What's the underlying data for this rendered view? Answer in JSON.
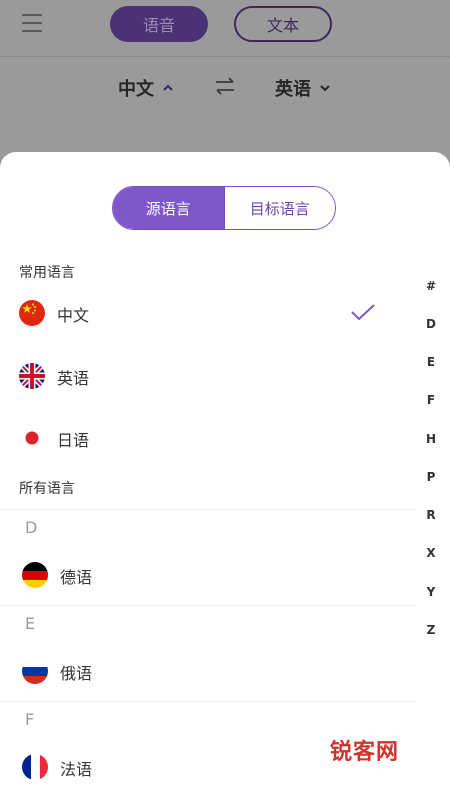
{
  "topbar": {
    "voice_label": "语音",
    "text_label": "文本"
  },
  "langbar": {
    "source": "中文",
    "target": "英语"
  },
  "segmented": {
    "source_label": "源语言",
    "target_label": "目标语言"
  },
  "common": {
    "title": "常用语言",
    "items": [
      {
        "name": "中文",
        "flag": "cn-flag-icon",
        "selected": true
      },
      {
        "name": "英语",
        "flag": "uk-flag-icon",
        "selected": false
      },
      {
        "name": "日语",
        "flag": "jp-flag-icon",
        "selected": false
      }
    ]
  },
  "all": {
    "title": "所有语言",
    "groups": [
      {
        "letter": "D",
        "items": [
          {
            "name": "德语",
            "flag": "de-flag-icon"
          }
        ]
      },
      {
        "letter": "E",
        "items": [
          {
            "name": "俄语",
            "flag": "ru-flag-icon"
          }
        ]
      },
      {
        "letter": "F",
        "items": [
          {
            "name": "法语",
            "flag": "fr-flag-icon"
          }
        ]
      }
    ]
  },
  "index_letters": [
    "#",
    "D",
    "E",
    "F",
    "H",
    "P",
    "R",
    "X",
    "Y",
    "Z"
  ],
  "colors": {
    "accent": "#7e57c9",
    "accent_dark": "#4b3275"
  },
  "watermark": {
    "logo": "锐客网"
  }
}
